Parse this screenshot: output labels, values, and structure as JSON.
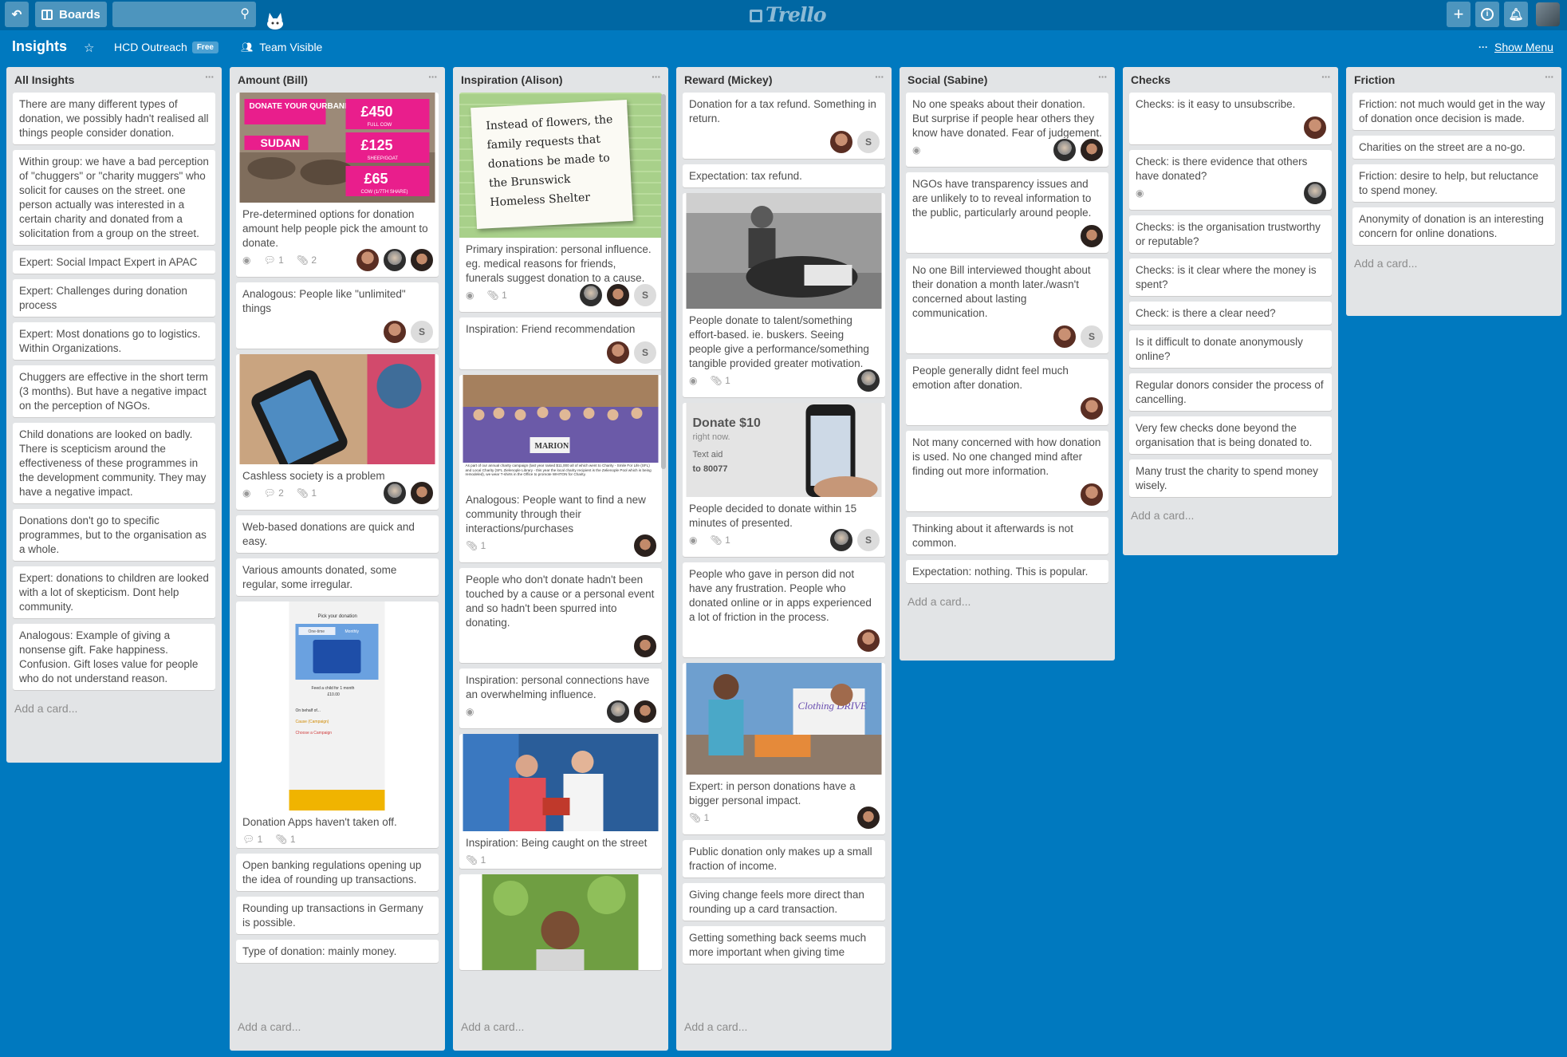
{
  "header": {
    "back_icon": "back-arrow-icon",
    "boards_label": "Boards",
    "search_placeholder": "",
    "search_icon": "search-icon",
    "logo_text": "Trello",
    "add_icon": "plus-icon",
    "info_icon": "info-icon",
    "bell_icon": "bell-icon"
  },
  "board": {
    "title": "Insights",
    "team": "HCD Outreach",
    "team_badge": "Free",
    "visibility": "Team Visible",
    "show_menu": "Show Menu",
    "menu_dots": "···"
  },
  "add_card_label": "Add a card...",
  "lists": [
    {
      "name": "All Insights",
      "cards": [
        {
          "text": "There are many different types of donation, we possibly hadn't realised all things people consider donation."
        },
        {
          "text": "Within group: we have a bad perception of \"chuggers\" or \"charity muggers\" who solicit for causes on the street. one person actually was interested in a certain charity and donated from a solicitation from a group on the street."
        },
        {
          "text": "Expert: Social Impact Expert in APAC"
        },
        {
          "text": "Expert: Challenges during donation process"
        },
        {
          "text": "Expert: Most donations go to logistics. Within Organizations."
        },
        {
          "text": "Chuggers are effective in the short term (3 months). But have a negative impact on the perception of NGOs."
        },
        {
          "text": "Child donations are looked on badly. There is scepticism around the effectiveness of these programmes in the development community. They may have a negative impact."
        },
        {
          "text": "Donations don't go to specific programmes, but to the organisation as a whole."
        },
        {
          "text": "Expert: donations to children are looked with a lot of skepticism. Dont help community."
        },
        {
          "text": "Analogous: Example of giving a nonsense gift. Fake happiness. Confusion. Gift loses value for people who do not understand reason."
        }
      ]
    },
    {
      "name": "Amount (Bill)",
      "cards": [
        {
          "img": "qurbani",
          "text": "Pre-determined options for donation amount help people pick the amount to donate.",
          "badges": {
            "eye": true,
            "comments": "1",
            "attach": "2"
          },
          "members": [
            "a1",
            "a2",
            "a3"
          ]
        },
        {
          "text": "Analogous: People like \"unlimited\" things",
          "members": [
            "a1",
            "S"
          ]
        },
        {
          "img": "phone",
          "text": "Cashless society is a problem",
          "badges": {
            "eye": true,
            "comments": "2",
            "attach": "1"
          },
          "members": [
            "a2",
            "a3"
          ]
        },
        {
          "text": "Web-based donations are quick and easy."
        },
        {
          "text": "Various amounts donated, some regular, some irregular."
        },
        {
          "img": "app",
          "text": "Donation Apps haven't taken off.",
          "badges": {
            "comments": "1",
            "attach": "1"
          }
        },
        {
          "text": "Open banking regulations opening up the idea of rounding up transactions."
        },
        {
          "text": "Rounding up transactions in Germany is possible."
        },
        {
          "text": "Type of donation: mainly money."
        }
      ],
      "image_text": {
        "qurbani_title": "DONATE YOUR QURBANI",
        "qurbani_place": "SUDAN",
        "prices": [
          "£450",
          "£125",
          "£65"
        ],
        "price_subs": [
          "FULL COW",
          "SHEEP/GOAT",
          "COW (1/7TH SHARE)"
        ],
        "app_header": "Pick your donation",
        "app_tab1": "One-time",
        "app_tab2": "Monthly",
        "app_caption": "Feed a child for 1 month",
        "app_amount": "£10.00",
        "app_rows": [
          "On behalf of...",
          "Cause (Campaign)",
          "Choose a Campaign"
        ]
      }
    },
    {
      "name": "Inspiration (Alison)",
      "cards": [
        {
          "img": "note",
          "text": "Primary inspiration: personal influence. eg. medical reasons for friends, funerals suggest donation to a cause.",
          "badges": {
            "eye": true,
            "attach": "1"
          },
          "members": [
            "a2",
            "a3",
            "S"
          ]
        },
        {
          "text": "Inspiration: Friend recommendation",
          "members": [
            "a1",
            "S"
          ]
        },
        {
          "img": "group",
          "text": "Analogous: People want to find a new community through their interactions/purchases",
          "badges": {
            "attach": "1"
          },
          "members": [
            "a3"
          ]
        },
        {
          "text": "People who don't donate hadn't been touched by a cause or a personal event and so hadn't been spurred into donating.",
          "members": [
            "a3"
          ]
        },
        {
          "text": "Inspiration: personal connections have an overwhelming influence.",
          "badges": {
            "eye": true
          },
          "members": [
            "a2",
            "a3"
          ]
        },
        {
          "img": "street",
          "text": "Inspiration: Being caught on the street",
          "badges": {
            "attach": "1"
          }
        },
        {
          "img": "portrait",
          "text": ""
        }
      ],
      "image_text": {
        "note": "Instead of flowers, the family requests that donations be made to the Brunswick Homeless Shelter",
        "group_sign": "MARION",
        "group_caption": "As part of our annual charity campaign (last year raised $11,000 all of which went to Charity - Smile For Life (SFL) and Local Charity (SFL Zielenople Library - this year the local charity recipient is the Zelienople Pool which is being remodeled), we wear T-shirts in the Office to promote WHITON for Charity."
      }
    },
    {
      "name": "Reward (Mickey)",
      "cards": [
        {
          "text": "Donation for a tax refund. Something in return.",
          "members": [
            "a1",
            "S"
          ]
        },
        {
          "text": "Expectation: tax refund."
        },
        {
          "img": "child",
          "text": "People donate to talent/something effort-based. ie. buskers. Seeing people give a performance/something tangible provided greater motivation.",
          "badges": {
            "eye": true,
            "attach": "1"
          },
          "members": [
            "a2"
          ]
        },
        {
          "img": "donate10",
          "text": "People decided to donate within 15 minutes of presented.",
          "badges": {
            "eye": true,
            "attach": "1"
          },
          "members": [
            "a2",
            "S"
          ]
        },
        {
          "text": "People who gave in person did not have any frustration. People who donated online or in apps experienced a lot of friction in the process.",
          "members": [
            "a1"
          ]
        },
        {
          "img": "clothing",
          "text": "Expert: in person donations have a bigger personal impact.",
          "badges": {
            "attach": "1"
          },
          "members": [
            "a3"
          ]
        },
        {
          "text": "Public donation only makes up a small fraction of income."
        },
        {
          "text": "Giving change feels more direct than rounding up a card transaction."
        },
        {
          "text": "Getting something back seems much more important when giving time"
        }
      ],
      "image_text": {
        "donate_title": "Donate $10",
        "donate_sub": "right now.",
        "donate_text": "Text aid",
        "donate_to": "to 80077",
        "clothing_sign": "Clothing DRIVE"
      }
    },
    {
      "name": "Social (Sabine)",
      "cards": [
        {
          "text": "No one speaks about their donation. But surprise if people hear others they know have donated. Fear of judgement.",
          "badges": {
            "eye": true
          },
          "members": [
            "a2",
            "a3"
          ]
        },
        {
          "text": "NGOs have transparency issues and are unlikely to to reveal information to the public, particularly around people.",
          "members": [
            "a3"
          ]
        },
        {
          "text": "No one Bill interviewed thought about their donation a month later./wasn't concerned about lasting communication.",
          "members": [
            "a1",
            "S"
          ]
        },
        {
          "text": "People generally didnt feel much emotion after donation.",
          "members": [
            "a1"
          ]
        },
        {
          "text": "Not many concerned with how donation is used. No one changed mind after finding out more information.",
          "members": [
            "a1"
          ]
        },
        {
          "text": "Thinking about it afterwards is not common."
        },
        {
          "text": "Expectation: nothing. This is popular."
        }
      ]
    },
    {
      "name": "Checks",
      "cards": [
        {
          "text": "Checks: is it easy to unsubscribe.",
          "members": [
            "a1"
          ]
        },
        {
          "text": "Check: is there evidence that others have donated?",
          "badges": {
            "eye": true
          },
          "members": [
            "a2"
          ]
        },
        {
          "text": "Checks: is the organisation trustworthy or reputable?"
        },
        {
          "text": "Checks: is it clear where the money is spent?"
        },
        {
          "text": "Check: is there a clear need?"
        },
        {
          "text": "Is it difficult to donate anonymously online?"
        },
        {
          "text": "Regular donors consider the process of cancelling."
        },
        {
          "text": "Very few checks done beyond the organisation that is being donated to."
        },
        {
          "text": "Many trust the charity to spend money wisely."
        }
      ]
    },
    {
      "name": "Friction",
      "cards": [
        {
          "text": "Friction: not much would get in the way of donation once decision is made."
        },
        {
          "text": "Charities on the street are a no-go."
        },
        {
          "text": "Friction: desire to help, but reluctance to spend money."
        },
        {
          "text": "Anonymity of donation is an interesting concern for online donations."
        }
      ]
    }
  ]
}
